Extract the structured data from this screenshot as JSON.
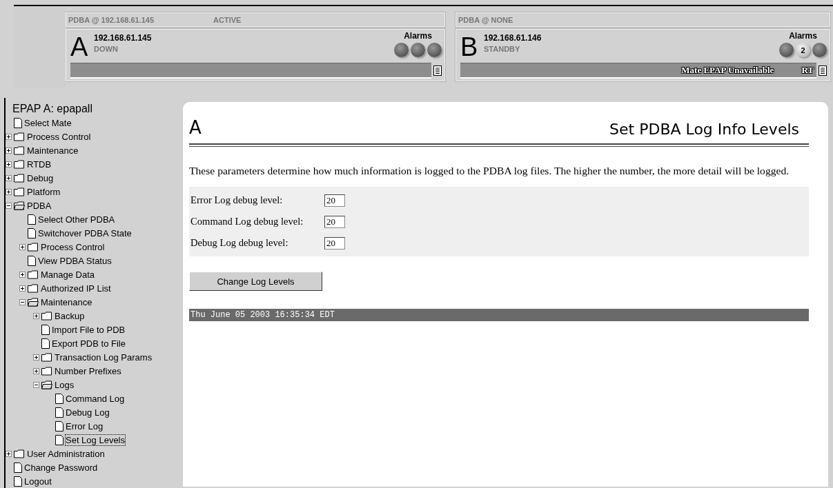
{
  "servers": [
    {
      "letter": "A",
      "header": "PDBA @ 192.168.61.145",
      "header_status": "ACTIVE",
      "ip": "192.168.61.145",
      "state": "DOWN",
      "alarms_label": "Alarms",
      "alarms": [
        {
          "kind": "lamp"
        },
        {
          "kind": "lamp"
        },
        {
          "kind": "lamp"
        }
      ]
    },
    {
      "letter": "B",
      "header": "PDBA @ NONE",
      "ip": "192.168.61.146",
      "state": "STANDBY",
      "alarms_label": "Alarms",
      "alarms": [
        {
          "kind": "lamp"
        },
        {
          "kind": "count",
          "text": "2"
        },
        {
          "kind": "lamp"
        }
      ],
      "message": "Mate EPAP Unavailable",
      "message_tag": "RT"
    }
  ],
  "sidebar": {
    "title": "EPAP A: epapall",
    "items": [
      {
        "kind": "page",
        "label": "Select Mate",
        "selected": false
      },
      {
        "kind": "folder",
        "label": "Process Control",
        "expanded": false,
        "selected": false
      },
      {
        "kind": "folder",
        "label": "Maintenance",
        "expanded": false,
        "selected": false
      },
      {
        "kind": "folder",
        "label": "RTDB",
        "expanded": false,
        "selected": false
      },
      {
        "kind": "folder",
        "label": "Debug",
        "expanded": false,
        "selected": false
      },
      {
        "kind": "folder",
        "label": "Platform",
        "expanded": false,
        "selected": false
      },
      {
        "kind": "folder",
        "label": "PDBA",
        "expanded": true,
        "selected": false,
        "children": [
          {
            "kind": "page",
            "label": "Select Other PDBA",
            "selected": false
          },
          {
            "kind": "page",
            "label": "Switchover PDBA State",
            "selected": false
          },
          {
            "kind": "folder",
            "label": "Process Control",
            "expanded": false,
            "selected": false
          },
          {
            "kind": "page",
            "label": "View PDBA Status",
            "selected": false
          },
          {
            "kind": "folder",
            "label": "Manage Data",
            "expanded": false,
            "selected": false
          },
          {
            "kind": "folder",
            "label": "Authorized IP List",
            "expanded": false,
            "selected": false
          },
          {
            "kind": "folder",
            "label": "Maintenance",
            "expanded": true,
            "selected": false,
            "children": [
              {
                "kind": "folder",
                "label": "Backup",
                "expanded": false,
                "selected": false
              },
              {
                "kind": "page",
                "label": "Import File to PDB",
                "selected": false
              },
              {
                "kind": "page",
                "label": "Export PDB to File",
                "selected": false
              },
              {
                "kind": "folder",
                "label": "Transaction Log Params",
                "expanded": false,
                "selected": false
              },
              {
                "kind": "folder",
                "label": "Number Prefixes",
                "expanded": false,
                "selected": false
              },
              {
                "kind": "folder",
                "label": "Logs",
                "expanded": true,
                "selected": false,
                "children": [
                  {
                    "kind": "page",
                    "label": "Command Log",
                    "selected": false
                  },
                  {
                    "kind": "page",
                    "label": "Debug Log",
                    "selected": false
                  },
                  {
                    "kind": "page",
                    "label": "Error Log",
                    "selected": false
                  },
                  {
                    "kind": "page",
                    "label": "Set Log Levels",
                    "selected": true
                  }
                ]
              }
            ]
          }
        ]
      },
      {
        "kind": "folder",
        "label": "User Administration",
        "expanded": false,
        "selected": false
      },
      {
        "kind": "page",
        "label": "Change Password",
        "selected": false
      },
      {
        "kind": "page",
        "label": "Logout",
        "selected": false
      }
    ]
  },
  "content": {
    "server_letter": "A",
    "title": "Set PDBA Log Info Levels",
    "description": "These parameters determine how much information is logged to the PDBA log files. The higher the number, the more detail will be logged.",
    "fields": [
      {
        "label": "Error Log debug level:",
        "value": "20"
      },
      {
        "label": "Command Log debug level:",
        "value": "20"
      },
      {
        "label": "Debug Log debug level:",
        "value": "20"
      }
    ],
    "button": "Change Log Levels",
    "timestamp": "Thu June 05 2003 16:35:34 EDT"
  }
}
